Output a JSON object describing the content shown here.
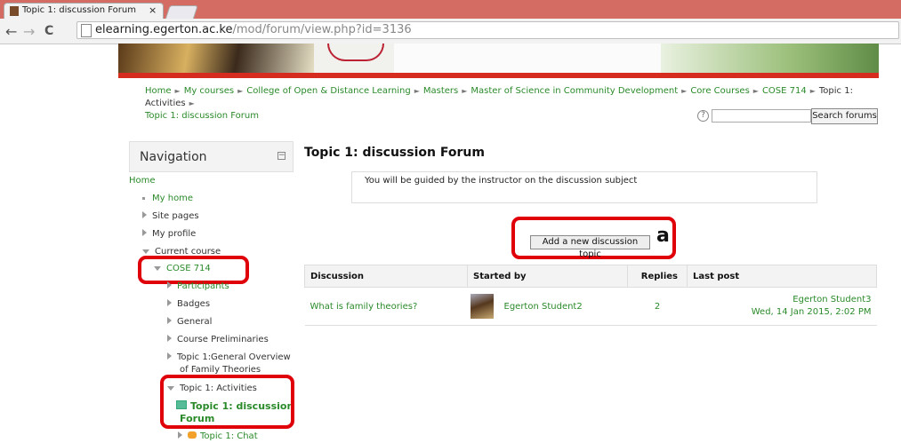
{
  "browser": {
    "tab_title": "Topic 1: discussion Forum",
    "tab_close": "×",
    "url_host": "elearning.egerton.ac.ke",
    "url_path": "/mod/forum/view.php?id=3136",
    "back": "←",
    "forward": "→",
    "reload": "C"
  },
  "breadcrumb": {
    "items": [
      "Home",
      "My courses",
      "College of Open & Distance Learning",
      "Masters",
      "Master of Science in Community Development",
      "Core Courses",
      "COSE 714",
      "Topic 1: Activities"
    ],
    "current": "Topic 1: discussion Forum",
    "separator": "►"
  },
  "search": {
    "help": "?",
    "placeholder": "",
    "button": "Search forums"
  },
  "navigation": {
    "title": "Navigation",
    "collapse": "−",
    "home": "Home",
    "my_home": "My home",
    "site_pages": "Site pages",
    "my_profile": "My profile",
    "current_course": "Current course",
    "course": "COSE 714",
    "participants": "Participants",
    "badges": "Badges",
    "general": "General",
    "course_preliminaries": "Course Preliminaries",
    "topic_overview_1": "Topic 1:General Overview",
    "topic_overview_2": "of Family Theories",
    "topic_activities": "Topic 1: Activities",
    "forum_1": "Topic 1: discussion",
    "forum_2": "Forum",
    "chat": "Topic 1: Chat"
  },
  "main": {
    "title": "Topic 1: discussion Forum",
    "description": "You will be guided by the instructor on the discussion subject",
    "add_button": "Add a new discussion topic",
    "annotation_label": "a",
    "table": {
      "headers": [
        "Discussion",
        "Started by",
        "Replies",
        "Last post"
      ],
      "rows": [
        {
          "discussion": "What is family theories?",
          "started_by": "Egerton Student2",
          "replies": "2",
          "last_post_user": "Egerton Student3",
          "last_post_date": "Wed, 14 Jan 2015, 2:02 PM"
        }
      ]
    }
  },
  "colors": {
    "link": "#2a8a2a",
    "highlight": "#e0000a",
    "tabstrip": "#d46c64"
  }
}
